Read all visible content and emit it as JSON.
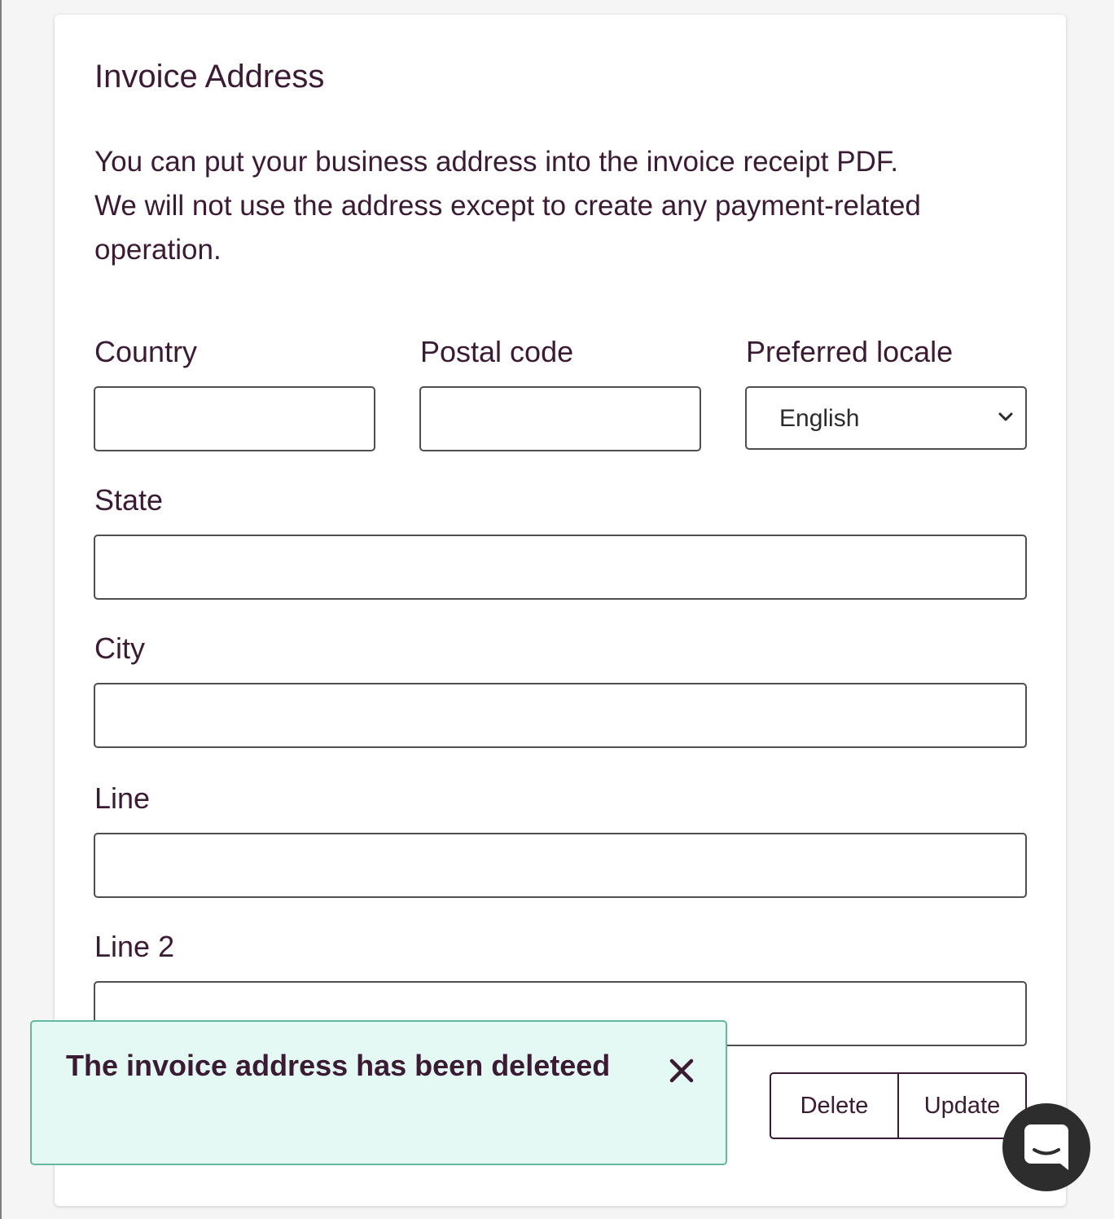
{
  "form": {
    "title": "Invoice Address",
    "description_lines": [
      "You can put your business address into the invoice receipt PDF.",
      "We will not use the address except to create any payment-related",
      "operation."
    ],
    "fields": {
      "country": {
        "label": "Country",
        "value": "",
        "placeholder": ""
      },
      "postal_code": {
        "label": "Postal code",
        "value": "",
        "placeholder": ""
      },
      "preferred_locale": {
        "label": "Preferred locale",
        "selected": "English"
      },
      "state": {
        "label": "State",
        "value": "",
        "placeholder": ""
      },
      "city": {
        "label": "City",
        "value": "",
        "placeholder": ""
      },
      "line": {
        "label": "Line",
        "value": "",
        "placeholder": ""
      },
      "line2": {
        "label": "Line 2",
        "value": "",
        "placeholder": ""
      }
    },
    "actions": {
      "delete_label": "Delete",
      "update_label": "Update"
    }
  },
  "toast": {
    "message": "The invoice address has been deleteed",
    "close_icon": "close-icon",
    "background": "#e4f9f3",
    "border": "#63b89f"
  },
  "chat_launcher": {
    "icon": "chat-icon"
  },
  "colors": {
    "text": "#3b1b34",
    "page_background": "#f5f5f5",
    "card_background": "#ffffff"
  }
}
